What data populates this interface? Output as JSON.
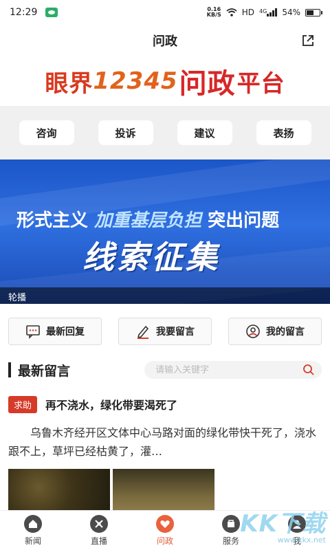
{
  "status_bar": {
    "time": "12:29",
    "net_speed_value": "0.16",
    "net_speed_unit": "KB/S",
    "hd": "HD",
    "network": "4G",
    "battery": "54%",
    "battery_level": 0.54
  },
  "header": {
    "title": "问政"
  },
  "brand": {
    "part1": "眼界",
    "part2": "12345",
    "part3": "问政",
    "part4": "平台"
  },
  "categories": [
    "咨询",
    "投诉",
    "建议",
    "表扬"
  ],
  "carousel": {
    "line1_a": "形式主义 ",
    "line1_b": "加重基层负担",
    "line1_c": " 突出问题",
    "line2": "线索征集",
    "caption": "轮播"
  },
  "actions": {
    "latest_reply": "最新回复",
    "leave_message": "我要留言",
    "my_messages": "我的留言"
  },
  "section": {
    "title": "最新留言",
    "search_placeholder": "请输入关键字"
  },
  "post": {
    "tag": "求助",
    "title": "再不浇水，绿化带要渴死了",
    "body": "乌鲁木齐经开区文体中心马路对面的绿化带快干死了，浇水跟不上，草坪已经枯黄了，灌…"
  },
  "tabbar": {
    "items": [
      "新闻",
      "直播",
      "问政",
      "服务",
      "我"
    ],
    "active": "问政"
  },
  "watermark": {
    "big": "KK下载",
    "small": "www.kkx.net"
  },
  "colors": {
    "accent": "#e8623b",
    "tag": "#d63a28",
    "carousel": "#2f6fe0"
  }
}
